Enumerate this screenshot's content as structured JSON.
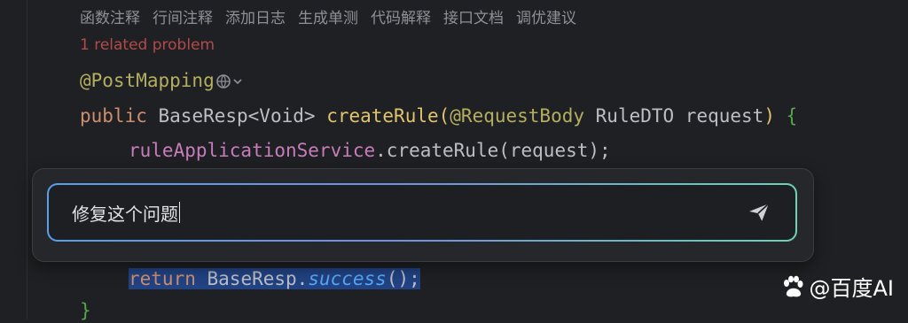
{
  "code_actions": [
    "函数注释",
    "行间注释",
    "添加日志",
    "生成单测",
    "代码解释",
    "接口文档",
    "调优建议"
  ],
  "problem_hint": "1 related problem",
  "code": {
    "annotation": "@PostMapping",
    "sig_public": "public",
    "sig_type": "BaseResp<Void>",
    "sig_method": "createRule",
    "sig_param_anno": "@RequestBody",
    "sig_param": "RuleDTO request",
    "sig_brace": "{",
    "call_target": "ruleApplicationService",
    "call_method": ".createRule(request);",
    "ret_kw": "return",
    "ret_obj": "BaseResp.",
    "ret_method": "success",
    "ret_end": "();",
    "close_brace": "}"
  },
  "prompt": {
    "value": "修复这个问题"
  },
  "watermark": "@百度AI"
}
